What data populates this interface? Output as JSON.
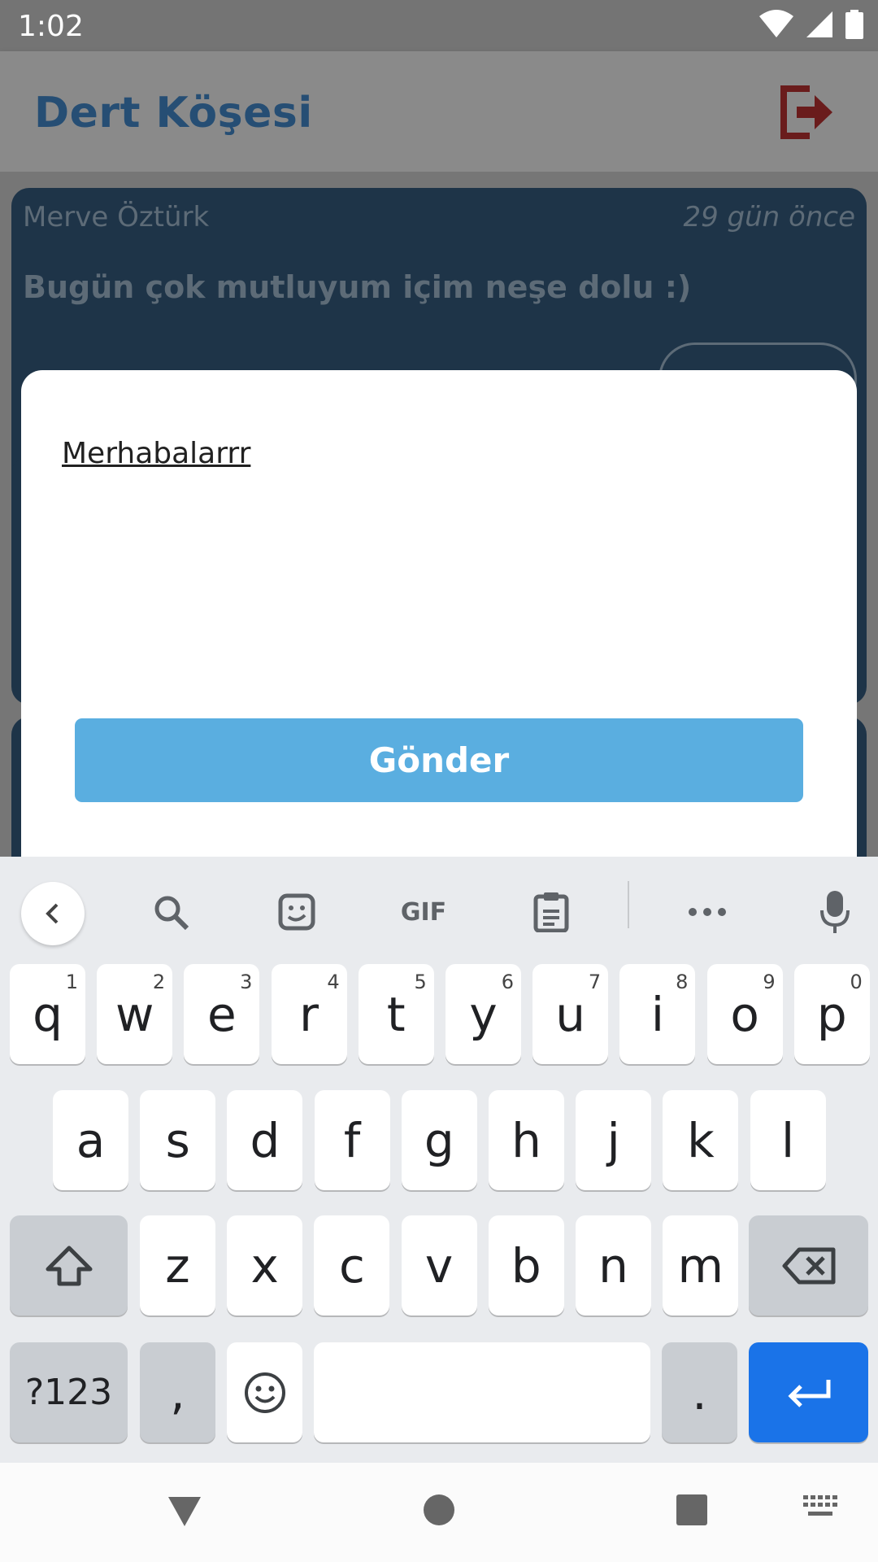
{
  "status_bar": {
    "time": "1:02"
  },
  "app_bar": {
    "title": "Dert Köşesi"
  },
  "posts": [
    {
      "author": "Merve Öztürk",
      "time": "29 gün önce",
      "text": "Bugün çok mutluyum içim neşe dolu :)"
    }
  ],
  "dialog": {
    "input_value": "Merhabalarrr",
    "send_label": "Gönder"
  },
  "keyboard": {
    "row1": [
      {
        "k": "q",
        "n": "1"
      },
      {
        "k": "w",
        "n": "2"
      },
      {
        "k": "e",
        "n": "3"
      },
      {
        "k": "r",
        "n": "4"
      },
      {
        "k": "t",
        "n": "5"
      },
      {
        "k": "y",
        "n": "6"
      },
      {
        "k": "u",
        "n": "7"
      },
      {
        "k": "i",
        "n": "8"
      },
      {
        "k": "o",
        "n": "9"
      },
      {
        "k": "p",
        "n": "0"
      }
    ],
    "row2": [
      "a",
      "s",
      "d",
      "f",
      "g",
      "h",
      "j",
      "k",
      "l"
    ],
    "row3": [
      "z",
      "x",
      "c",
      "v",
      "b",
      "n",
      "m"
    ],
    "symbols_label": "?123",
    "comma_label": ",",
    "period_label": ".",
    "suggestion_icons": [
      "back-icon",
      "search-icon",
      "sticker-icon",
      "gif-icon",
      "clipboard-icon",
      "more-icon",
      "mic-icon"
    ],
    "gif_label": "GIF"
  },
  "colors": {
    "accent": "#1a73e8",
    "send_button": "#5aaee0",
    "title": "#264e74"
  }
}
